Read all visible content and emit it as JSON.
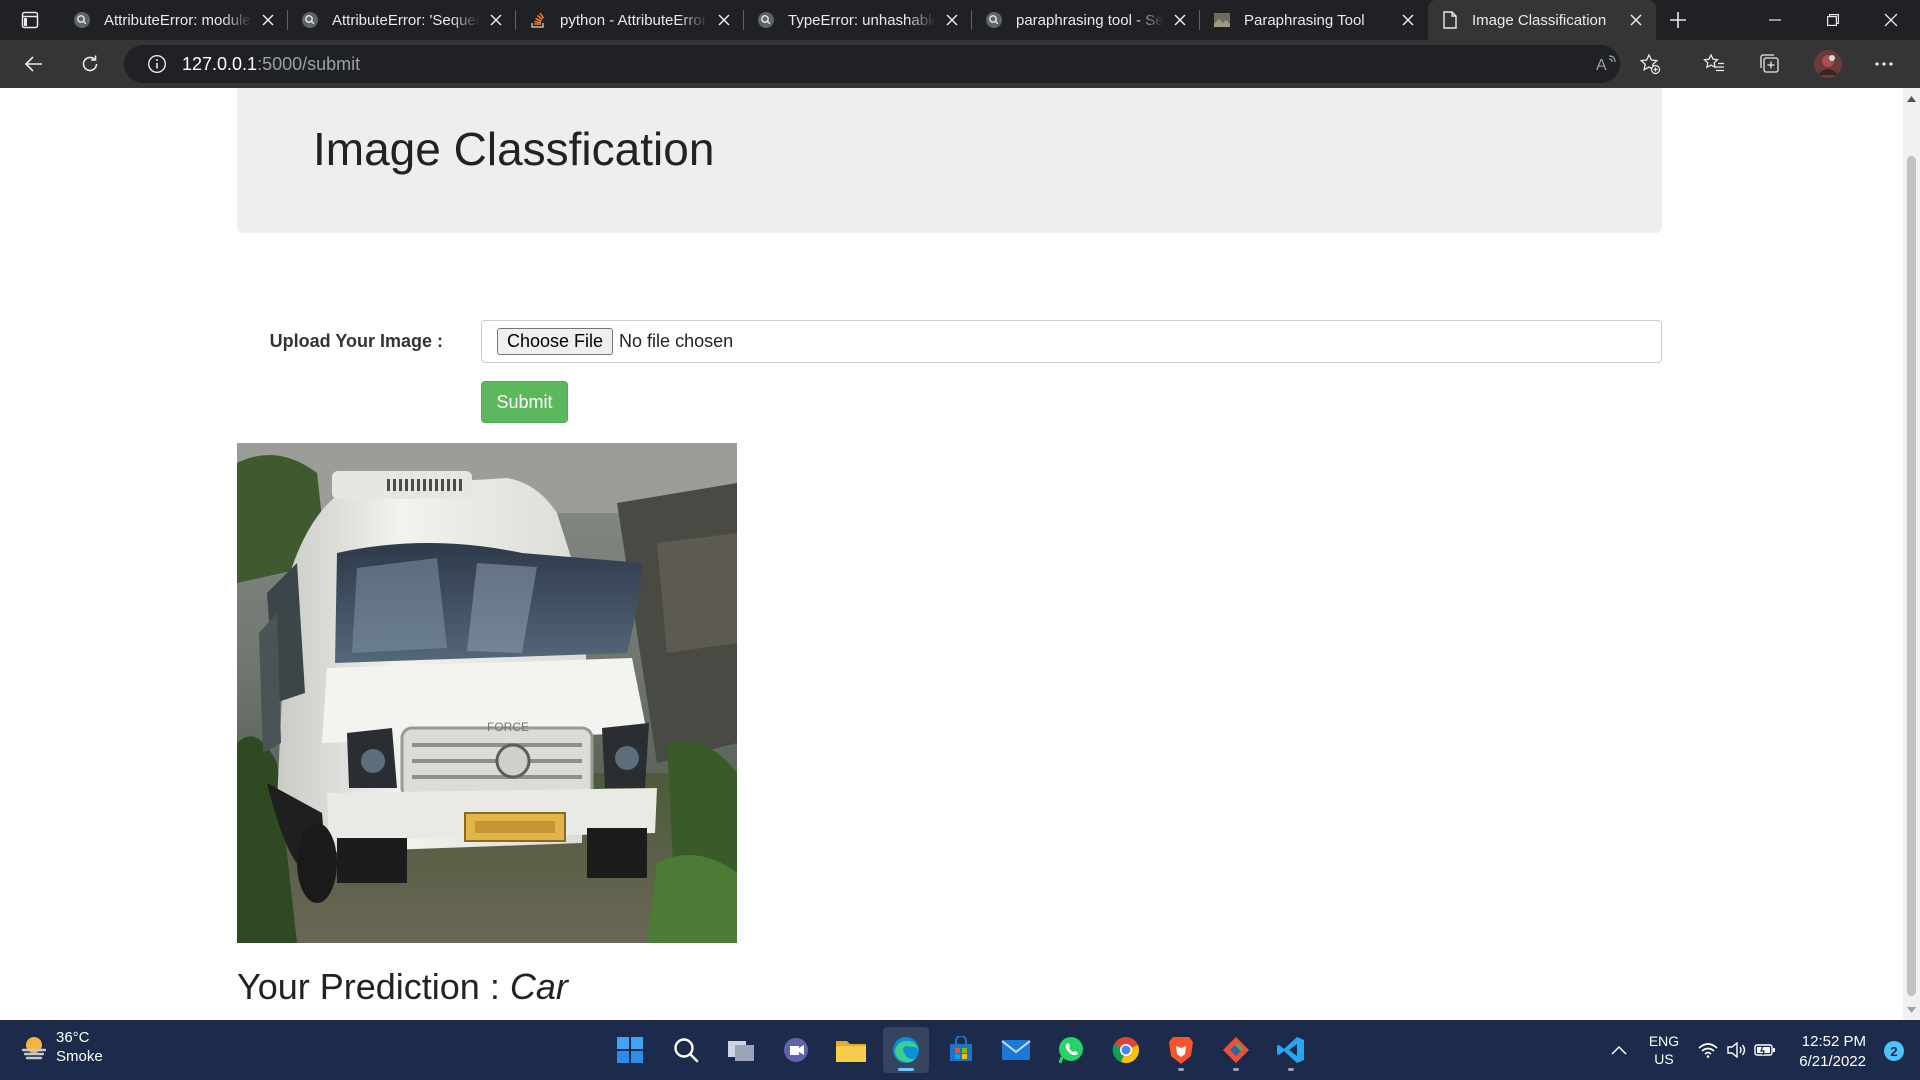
{
  "browser": {
    "tabs": [
      {
        "title": "AttributeError: module",
        "favicon": "search-icon",
        "active": false
      },
      {
        "title": "AttributeError: 'Sequen",
        "favicon": "search-icon",
        "active": false
      },
      {
        "title": "python - AttributeError",
        "favicon": "stackoverflow-icon",
        "active": false
      },
      {
        "title": "TypeError: unhashable",
        "favicon": "search-icon",
        "active": false
      },
      {
        "title": "paraphrasing tool - Se",
        "favicon": "search-icon",
        "active": false
      },
      {
        "title": "Paraphrasing Tool",
        "favicon": "image-icon",
        "active": false
      },
      {
        "title": "Image Classification",
        "favicon": "page-icon",
        "active": true
      }
    ],
    "address": {
      "host": "127.0.0.1",
      "path": ":5000/submit"
    }
  },
  "page": {
    "heading": "Image Classfication",
    "upload_label": "Upload Your Image :",
    "file_button": "Choose File",
    "file_status": "No file chosen",
    "submit_label": "Submit",
    "image_subject": "white van",
    "prediction_prefix": "Your Prediction :",
    "prediction_value": "Car"
  },
  "taskbar": {
    "weather": {
      "temp": "36°C",
      "condition": "Smoke"
    },
    "apps": [
      "windows-start-icon",
      "search-icon",
      "task-view-icon",
      "teams-chat-icon",
      "file-explorer-icon",
      "edge-icon",
      "store-icon",
      "mail-icon",
      "whatsapp-icon",
      "chrome-icon",
      "brave-icon",
      "git-icon",
      "vscode-icon"
    ],
    "lang_top": "ENG",
    "lang_bottom": "US",
    "time": "12:52 PM",
    "date": "6/21/2022",
    "notifications": "2"
  },
  "colors": {
    "tabstrip": "#202124",
    "toolbar": "#353535",
    "jumbotron": "#eeeeee",
    "submit": "#5cb85c",
    "taskbar": "#1c2b4b"
  }
}
